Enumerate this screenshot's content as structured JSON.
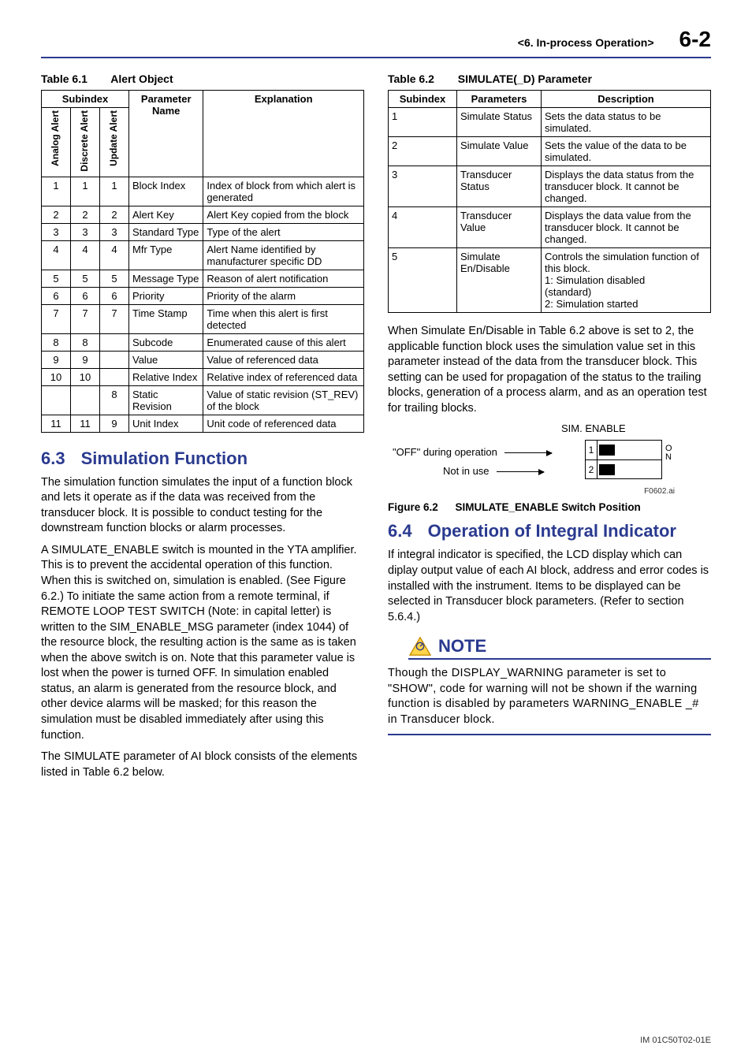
{
  "header": {
    "section": "<6.  In-process Operation>",
    "page": "6-2"
  },
  "t61": {
    "caption_num": "Table 6.1",
    "caption_txt": "Alert Object",
    "col_subindex": "Subindex",
    "col_param": "Parameter Name",
    "col_expl": "Explanation",
    "v_analog": "Analog Alert",
    "v_discrete": "Discrete Alert",
    "v_update": "Update Alert",
    "rows": [
      {
        "a": "1",
        "d": "1",
        "u": "1",
        "p": "Block Index",
        "e": "Index of block from which alert is generated"
      },
      {
        "a": "2",
        "d": "2",
        "u": "2",
        "p": "Alert Key",
        "e": "Alert Key copied from the block"
      },
      {
        "a": "3",
        "d": "3",
        "u": "3",
        "p": "Standard Type",
        "e": "Type of the alert"
      },
      {
        "a": "4",
        "d": "4",
        "u": "4",
        "p": "Mfr Type",
        "e": "Alert Name identified by manufacturer specific DD"
      },
      {
        "a": "5",
        "d": "5",
        "u": "5",
        "p": "Message Type",
        "e": "Reason of alert notification"
      },
      {
        "a": "6",
        "d": "6",
        "u": "6",
        "p": "Priority",
        "e": "Priority of the alarm"
      },
      {
        "a": "7",
        "d": "7",
        "u": "7",
        "p": "Time Stamp",
        "e": "Time when this alert is first detected"
      },
      {
        "a": "8",
        "d": "8",
        "u": "",
        "p": "Subcode",
        "e": "Enumerated cause of this alert"
      },
      {
        "a": "9",
        "d": "9",
        "u": "",
        "p": "Value",
        "e": "Value of referenced data"
      },
      {
        "a": "10",
        "d": "10",
        "u": "",
        "p": "Relative Index",
        "e": "Relative index of referenced data"
      },
      {
        "a": "",
        "d": "",
        "u": "8",
        "p": "Static Revision",
        "e": "Value of static revision (ST_REV) of the block"
      },
      {
        "a": "11",
        "d": "11",
        "u": "9",
        "p": "Unit Index",
        "e": "Unit code of referenced data"
      }
    ]
  },
  "sec63": {
    "num": "6.3",
    "title": "Simulation Function",
    "p1": "The simulation function simulates the input of a function block and lets it operate as if the data was received from the transducer block. It is possible to conduct testing for the downstream function blocks or alarm processes.",
    "p2": "A SIMULATE_ENABLE switch is mounted in the YTA amplifier. This is to prevent the accidental operation of this function. When this is switched on, simulation is enabled. (See Figure 6.2.) To initiate the same action from a remote terminal, if REMOTE LOOP TEST SWITCH (Note: in capital letter) is written to the SIM_ENABLE_MSG parameter (index 1044) of the resource block, the resulting action is the same as is taken when the above switch is on. Note that this parameter value is lost when the power is turned OFF. In simulation enabled status, an alarm is generated from the resource block, and other device alarms will be masked; for this reason the simulation must be disabled immediately after using this function.",
    "p3": "The SIMULATE parameter of AI block consists of the elements listed in Table 6.2 below."
  },
  "t62": {
    "caption_num": "Table 6.2",
    "caption_txt": "SIMULATE(_D) Parameter",
    "h1": "Subindex",
    "h2": "Parameters",
    "h3": "Description",
    "rows": [
      {
        "s": "1",
        "p": "Simulate Status",
        "d": "Sets the data status to be simulated."
      },
      {
        "s": "2",
        "p": "Simulate Value",
        "d": "Sets the value of the data to be simulated."
      },
      {
        "s": "3",
        "p": "Transducer Status",
        "d": "Displays the data status from the transducer block. It cannot be changed."
      },
      {
        "s": "4",
        "p": "Transducer Value",
        "d": "Displays the data value from the transducer block. It cannot be changed."
      },
      {
        "s": "5",
        "p": "Simulate En/Disable",
        "d": "Controls the simulation function of this block.\n   1: Simulation disabled\n       (standard)\n   2: Simulation started"
      }
    ]
  },
  "rightp": "When Simulate En/Disable in Table 6.2 above is set to 2, the applicable function block uses the simulation value set in this parameter instead of the data from the transducer block. This setting can be used for propagation of the status to the trailing blocks, generation of a process alarm, and as an operation test for trailing blocks.",
  "fig": {
    "sim": "SIM. ENABLE",
    "off": "\"OFF\" during operation",
    "notin": "Not in use",
    "row1": "1",
    "row2": "2",
    "on": "O\nN",
    "ref": "F0602.ai",
    "cap_num": "Figure 6.2",
    "cap_txt": "SIMULATE_ENABLE Switch Position"
  },
  "sec64": {
    "num": "6.4",
    "title": "Operation of Integral Indicator",
    "p1": "If integral indicator is specified, the LCD display which can diplay output value of each AI block, address and error codes is installed with the instrument. Items to be displayed can be selected in Transducer block parameters. (Refer to section 5.6.4.)"
  },
  "note": {
    "label": "NOTE",
    "body": "Though the DISPLAY_WARNING parameter is set to \"SHOW\", code for warning will not be shown if the warning function is disabled by parameters WARNING_ENABLE _# in Transducer block."
  },
  "footer": "IM 01C50T02-01E"
}
